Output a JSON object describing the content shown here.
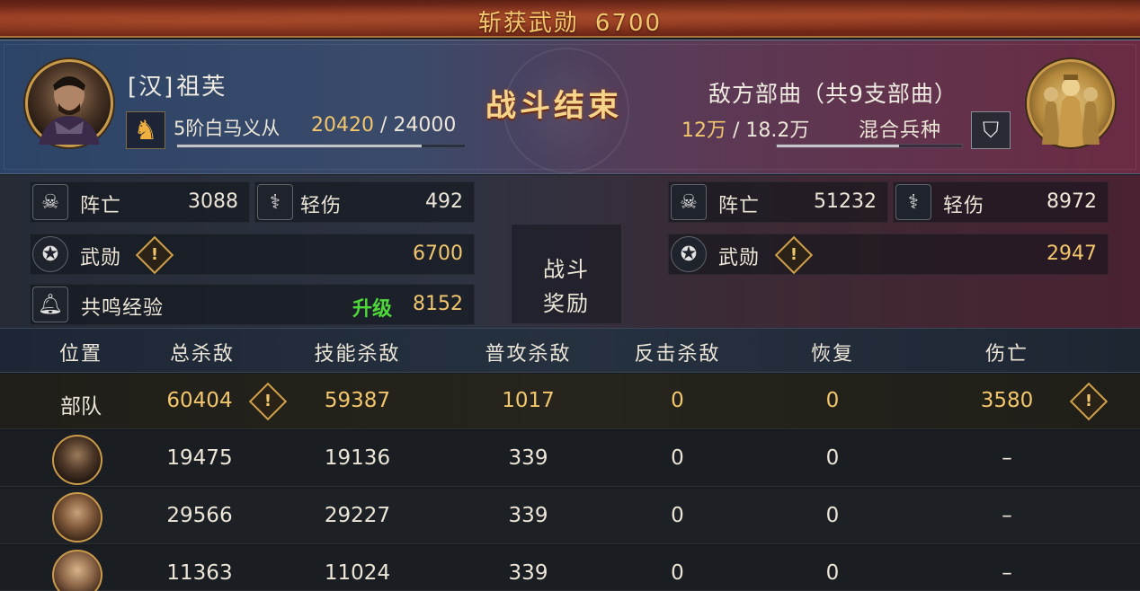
{
  "banner": {
    "label": "斩获武勋",
    "value": "6700"
  },
  "player": {
    "faction": "[汉]",
    "name": "祖芙",
    "unit_name": "5阶白马义从",
    "unit_xp": "20420",
    "unit_xp_max": "24000",
    "unit_xp_progress": 0.85
  },
  "result_title": "战斗结束",
  "enemy": {
    "title": "敌方部曲（共9支部曲）",
    "troops": "12万",
    "troops_max": "18.2万",
    "troop_type": "混合兵种",
    "troops_progress": 0.66
  },
  "stats_left": {
    "dead_label": "阵亡",
    "dead": "3088",
    "wounded_label": "轻伤",
    "wounded": "492",
    "merit_label": "武勋",
    "merit": "6700",
    "resonance_label": "共鸣经验",
    "upgrade_label": "升级",
    "resonance": "8152"
  },
  "stats_right": {
    "dead_label": "阵亡",
    "dead": "51232",
    "wounded_label": "轻伤",
    "wounded": "8972",
    "merit_label": "武勋",
    "merit": "2947"
  },
  "reward": {
    "line1": "战斗",
    "line2": "奖励"
  },
  "table": {
    "headers": [
      "位置",
      "总杀敌",
      "技能杀敌",
      "普攻杀敌",
      "反击杀敌",
      "恢复",
      "伤亡"
    ],
    "rows": [
      {
        "position": "部队",
        "total": "60404",
        "skill": "59387",
        "normal": "1017",
        "counter": "0",
        "heal": "0",
        "loss": "3580"
      },
      {
        "total": "19475",
        "skill": "19136",
        "normal": "339",
        "counter": "0",
        "heal": "0",
        "loss": "–"
      },
      {
        "total": "29566",
        "skill": "29227",
        "normal": "339",
        "counter": "0",
        "heal": "0",
        "loss": "–"
      },
      {
        "total": "11363",
        "skill": "11024",
        "normal": "339",
        "counter": "0",
        "heal": "0",
        "loss": "–"
      }
    ]
  },
  "warn_glyph": "!",
  "icons": {
    "skull": "skull-icon",
    "wounded": "wounded-soldier-icon",
    "merit": "merit-medal-icon",
    "bell": "bell-icon",
    "horse": "horse-icon",
    "mixed": "mixed-troops-icon"
  },
  "colors": {
    "gold": "#f2c66d",
    "upgrade_green": "#4ed83a"
  }
}
